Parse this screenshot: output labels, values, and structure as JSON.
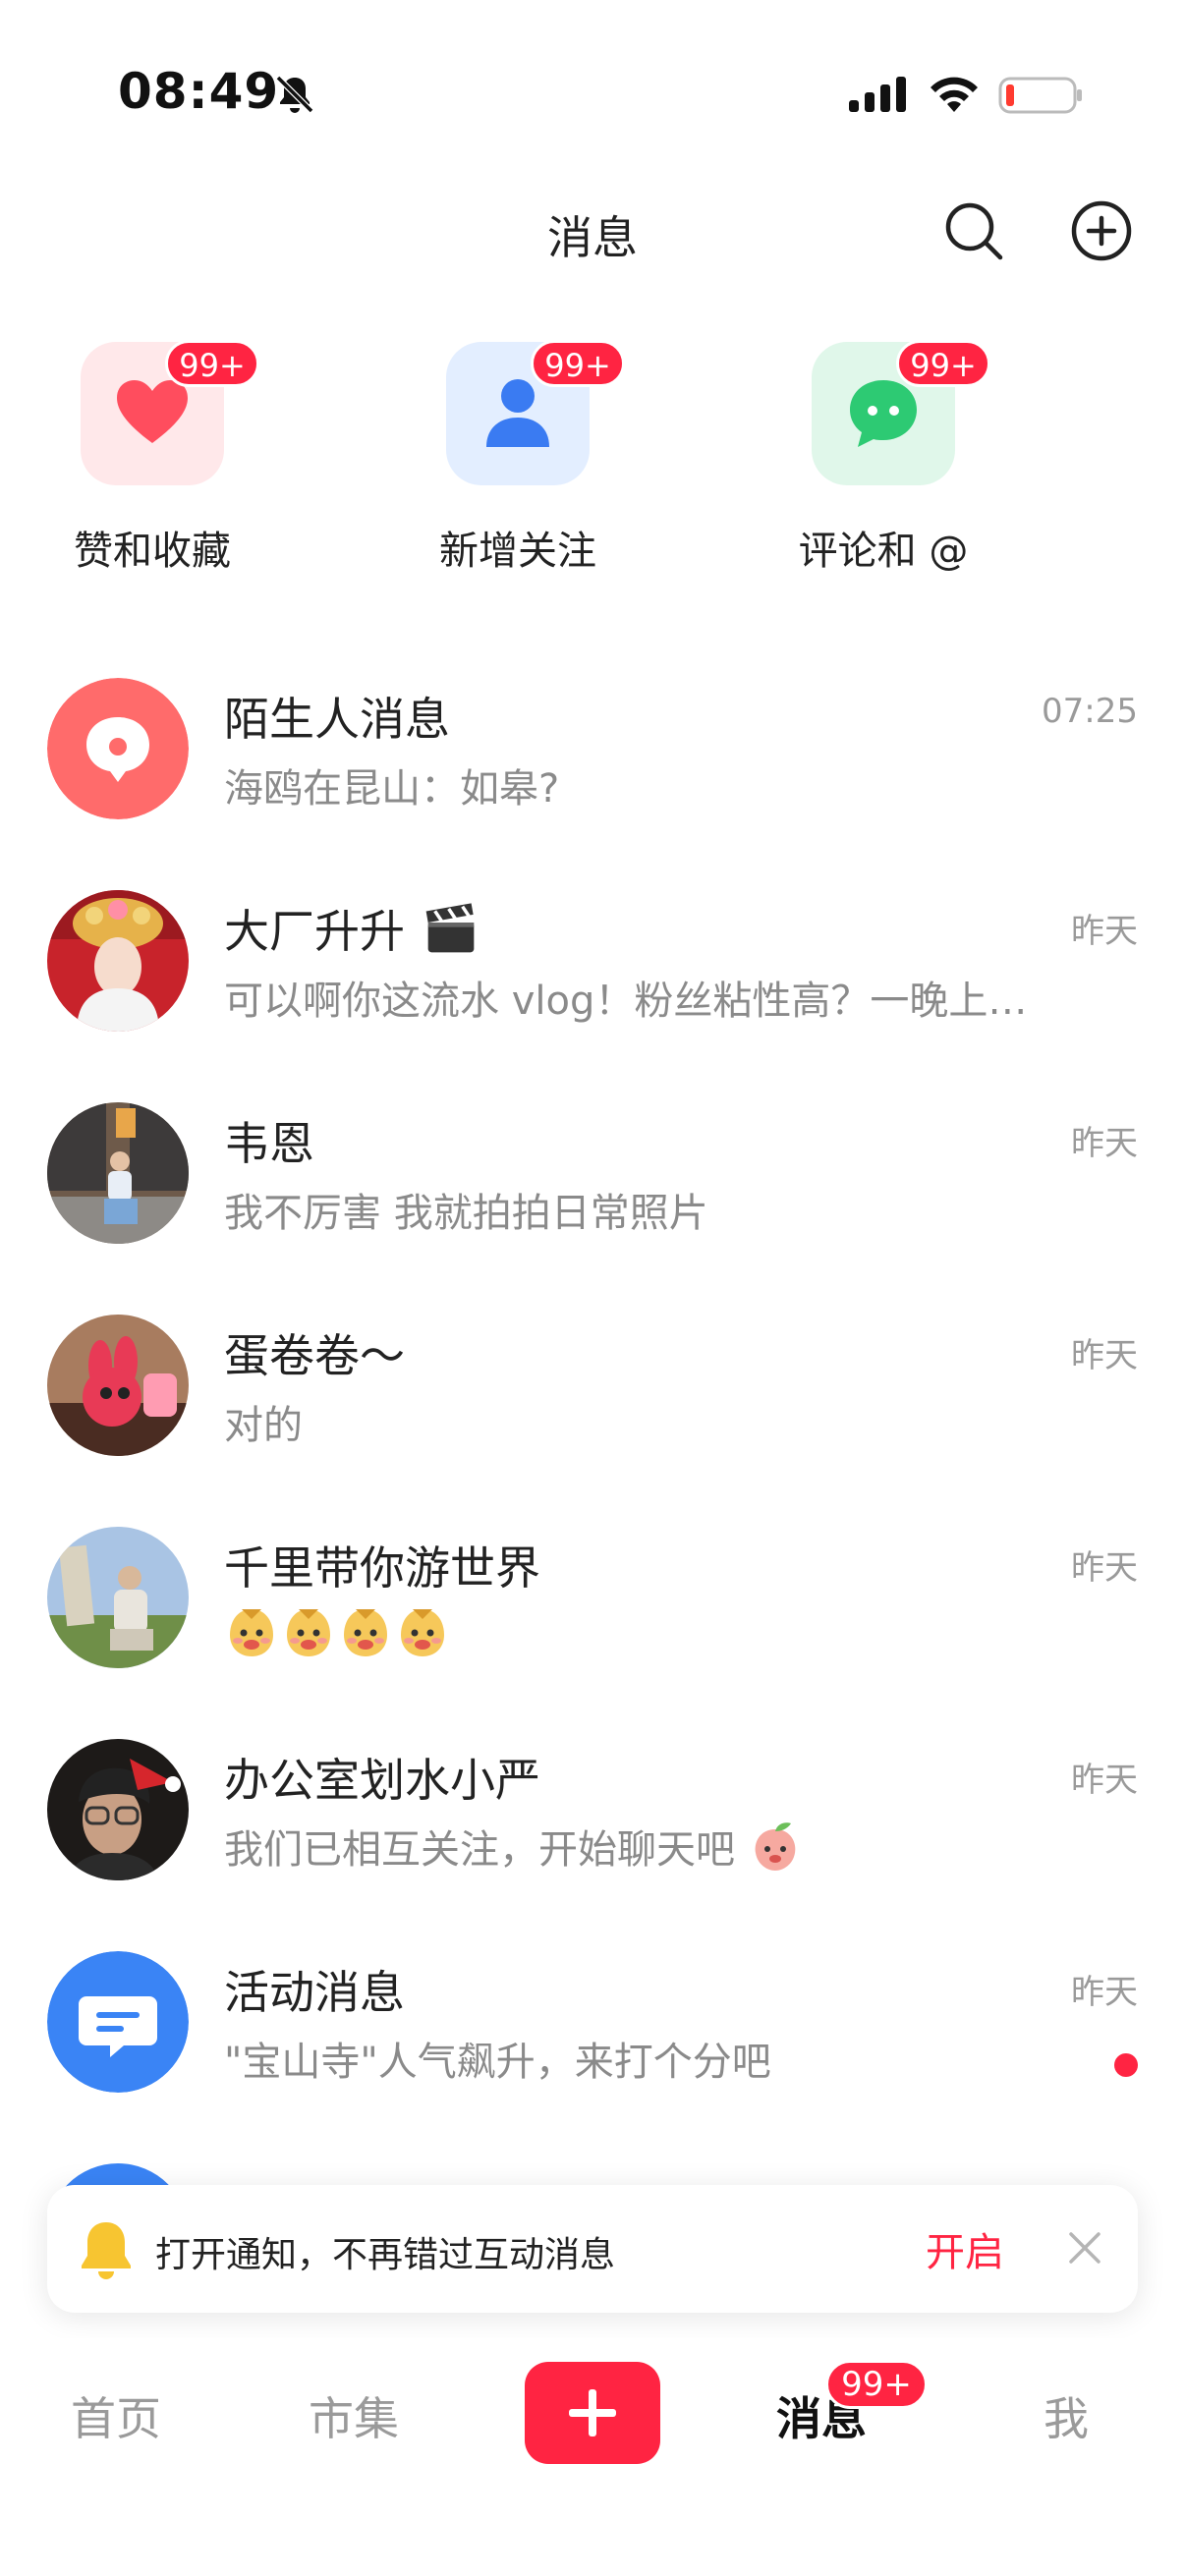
{
  "status_bar": {
    "time": "08:49",
    "icons": [
      "bell-off-icon",
      "signal-icon",
      "wifi-icon",
      "battery-low-icon"
    ]
  },
  "header": {
    "title": "消息",
    "icons": [
      "search-icon",
      "add-circle-icon"
    ]
  },
  "quick_actions": [
    {
      "label": "赞和收藏",
      "badge": "99+",
      "icon": "heart-icon",
      "color": "#ff4d5e"
    },
    {
      "label": "新增关注",
      "badge": "99+",
      "icon": "person-icon",
      "color": "#3a7bf2"
    },
    {
      "label": "评论和 @",
      "badge": "99+",
      "icon": "chat-bubble-icon",
      "color": "#2dca73"
    }
  ],
  "messages": [
    {
      "name": "陌生人消息",
      "preview": "海鸥在昆山：如皋?",
      "time": "07:25",
      "avatar": "stranger-message-icon"
    },
    {
      "name": "大厂升升",
      "name_icon": "clapperboard-emoji",
      "preview": "可以啊你这流水 vlog！粉丝粘性高？一晚上…",
      "time": "昨天",
      "avatar": "avatar-photo"
    },
    {
      "name": "韦恩",
      "preview": "我不厉害 我就拍拍日常照片",
      "time": "昨天",
      "avatar": "avatar-photo"
    },
    {
      "name": "蛋卷卷～",
      "preview": "对的",
      "time": "昨天",
      "avatar": "avatar-photo"
    },
    {
      "name": "千里带你游世界",
      "preview_icons": [
        "sticker-emoji",
        "sticker-emoji",
        "sticker-emoji",
        "sticker-emoji"
      ],
      "time": "昨天",
      "avatar": "avatar-photo"
    },
    {
      "name": "办公室划水小严",
      "preview": "我们已相互关注，开始聊天吧",
      "preview_icon": "peach-sticker-emoji",
      "time": "昨天",
      "avatar": "avatar-photo"
    },
    {
      "name": "活动消息",
      "preview": "\"宝山寺\"人气飙升，来打个分吧",
      "time": "昨天",
      "avatar": "activity-message-icon",
      "unread": true
    }
  ],
  "notification_banner": {
    "text": "打开通知，不再错过互动消息",
    "action": "开启",
    "icons": [
      "bell-icon",
      "close-icon"
    ]
  },
  "tabbar": {
    "home": "首页",
    "market": "市集",
    "messages": "消息",
    "messages_badge": "99+",
    "me": "我"
  },
  "colors": {
    "accent": "#ff2442",
    "muted_text": "#8a8a8a"
  }
}
